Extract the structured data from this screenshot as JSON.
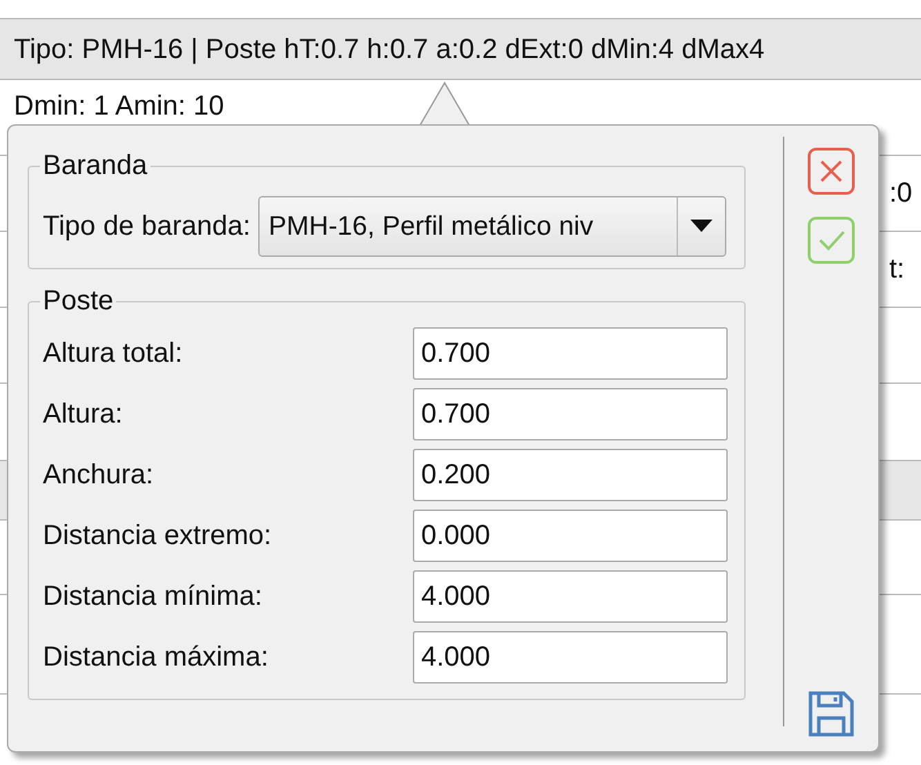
{
  "table": {
    "rows": [
      {
        "selected": false
      },
      {
        "selected": true,
        "column_1": "Tipo: PMH-16 | Poste hT:0.7 h:0.7 a:0.2 dExt:0 dMin:4 dMax4"
      },
      {
        "selected": false,
        "column_1": "Dmin: 1 Amin: 10"
      },
      {
        "selected": false,
        "column_2": ":0"
      },
      {
        "selected": false,
        "column_2": "t:"
      },
      {
        "selected": false
      },
      {
        "selected": false
      },
      {
        "selected": true
      },
      {
        "selected": false
      },
      {
        "selected": false
      }
    ]
  },
  "popup": {
    "baranda": {
      "title": "Baranda",
      "label": "Tipo de baranda:",
      "value": "PMH-16, Perfil metálico niv"
    },
    "poste": {
      "title": "Poste",
      "fields": [
        {
          "label": "Altura total:",
          "value": "0.700"
        },
        {
          "label": "Altura:",
          "value": "0.700"
        },
        {
          "label": "Anchura:",
          "value": "0.200"
        },
        {
          "label": "Distancia extremo:",
          "value": "0.000"
        },
        {
          "label": "Distancia mínima:",
          "value": "4.000"
        },
        {
          "label": "Distancia máxima:",
          "value": "4.000"
        }
      ]
    },
    "actions": [
      {
        "kind": "cancel"
      },
      {
        "kind": "accept"
      },
      {
        "kind": "save"
      }
    ]
  }
}
